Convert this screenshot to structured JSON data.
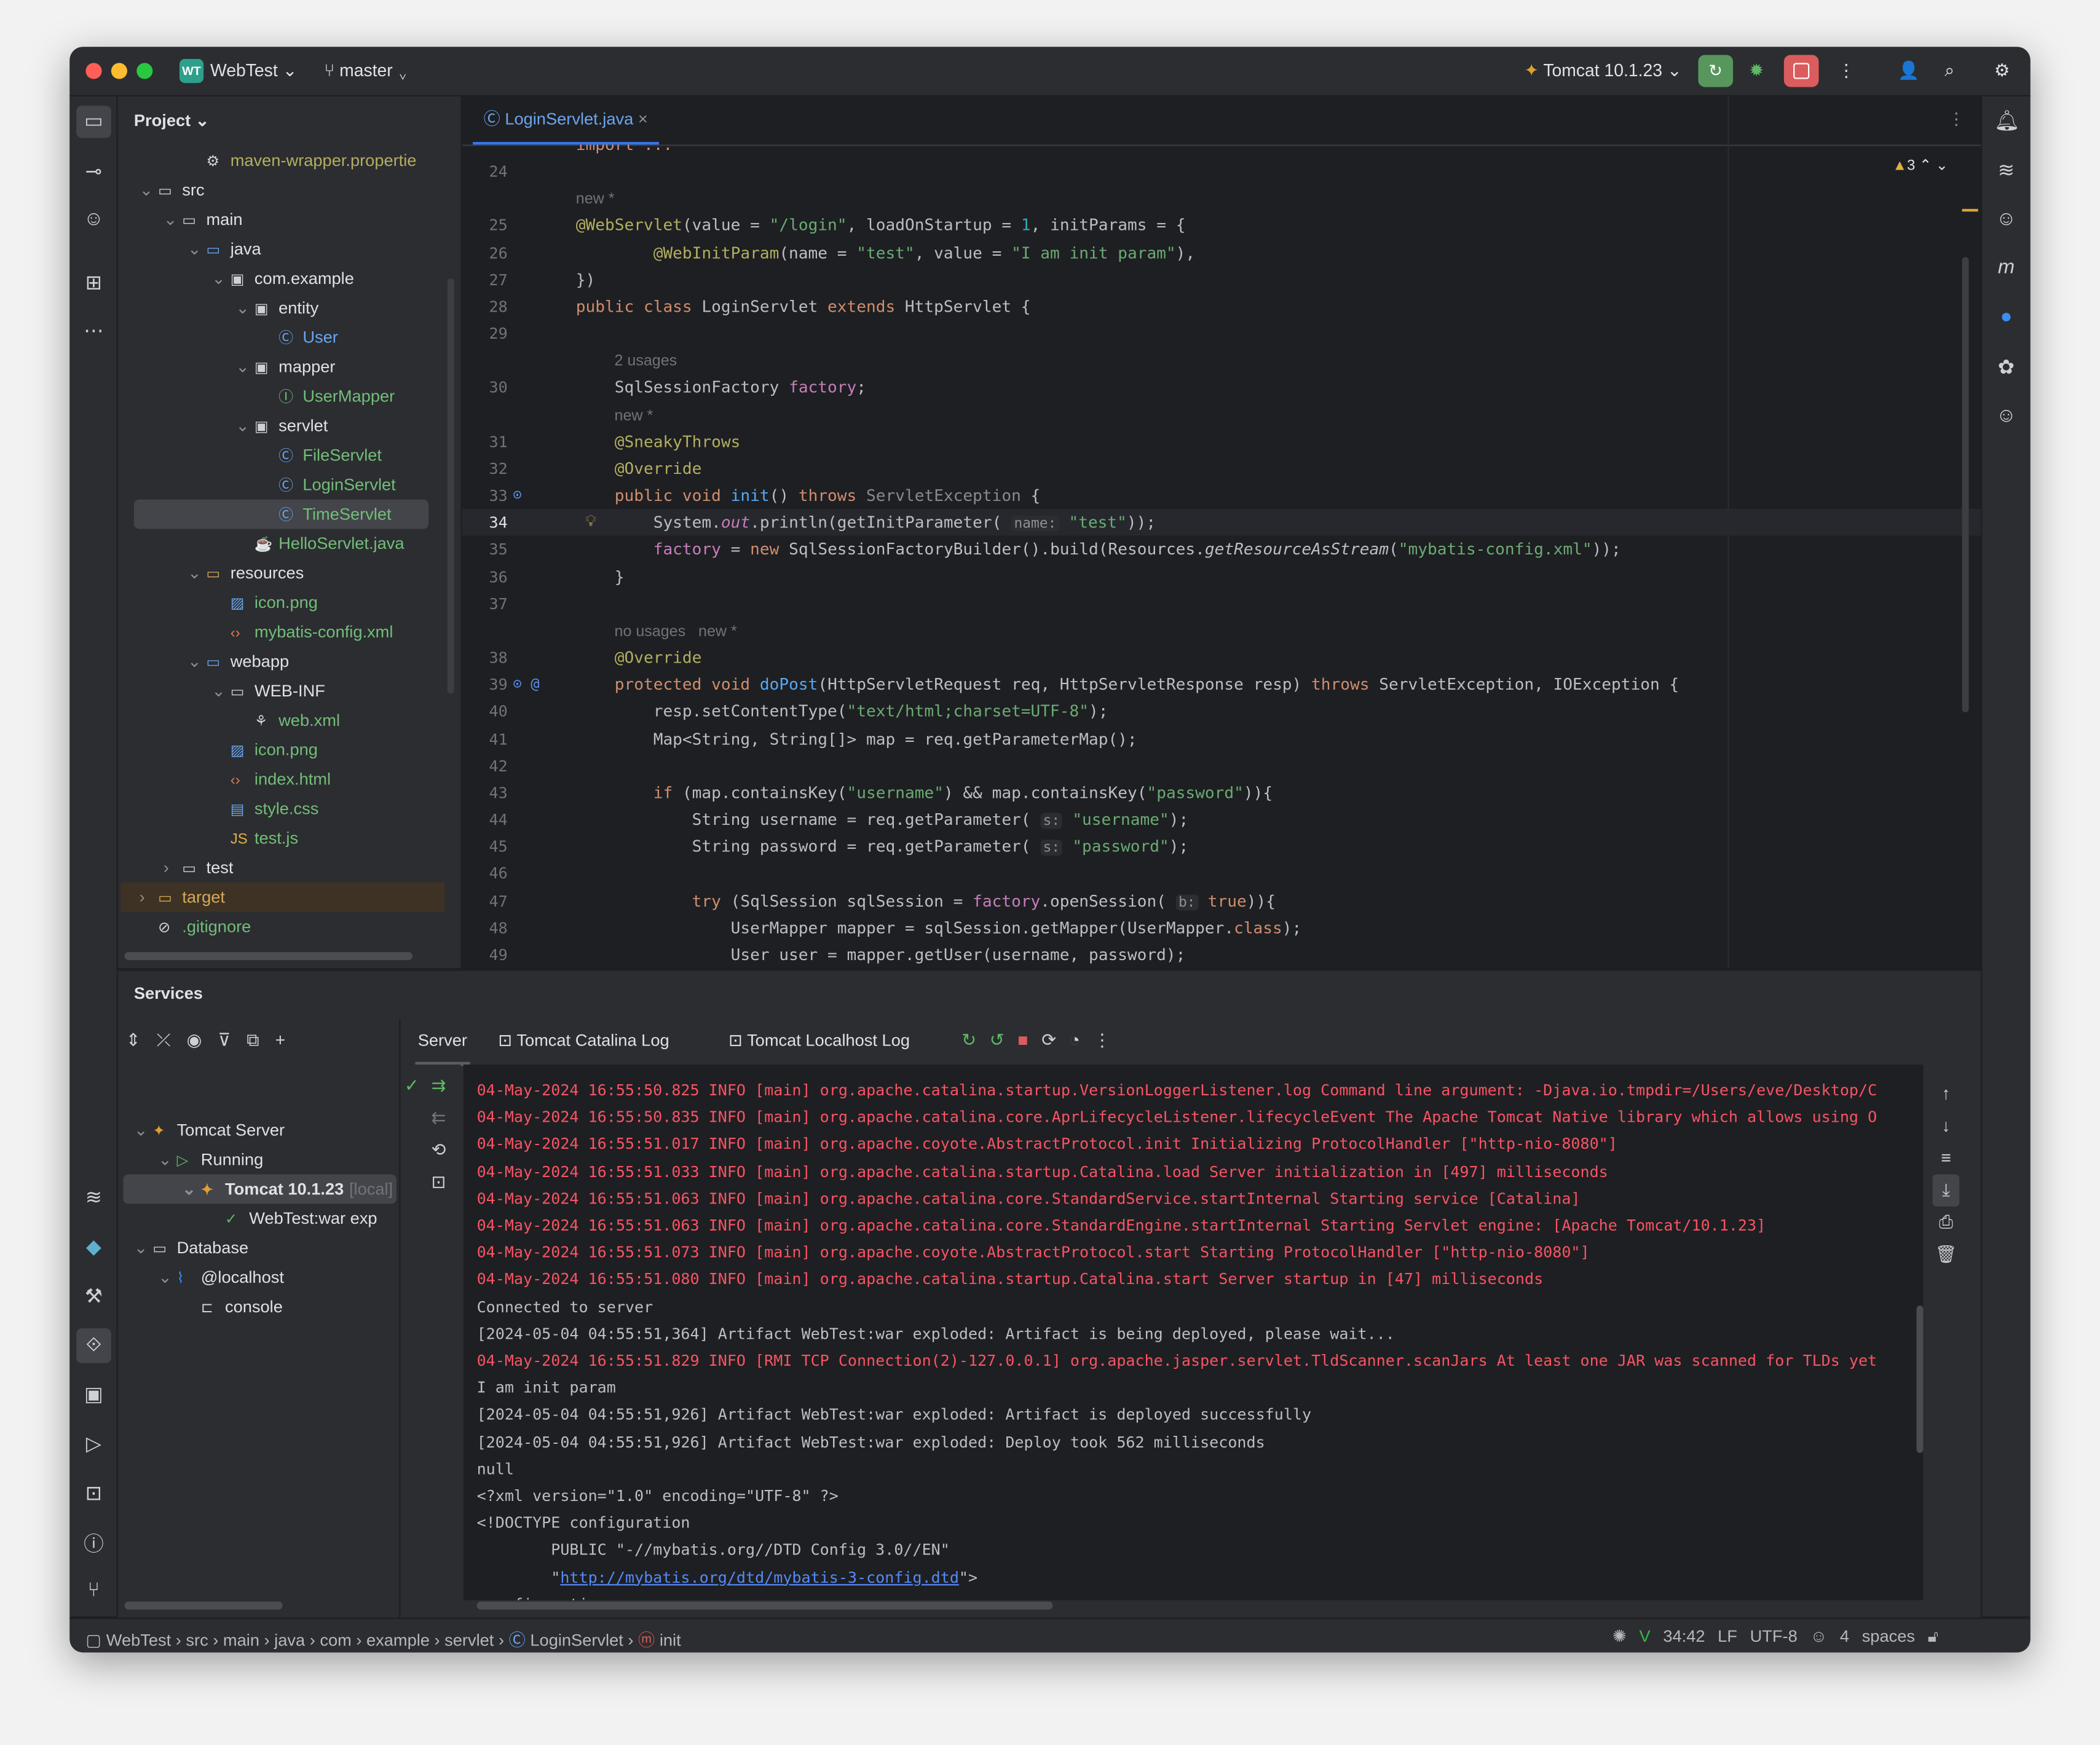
{
  "titlebar": {
    "project_badge": "WT",
    "project": "WebTest",
    "branch": "master",
    "run_config": "Tomcat 10.1.23"
  },
  "colors": {
    "accent": "#3574f0",
    "keyword": "#cf8e6d",
    "annotation": "#b3ae60",
    "string": "#6aab73",
    "error": "#f75464",
    "run_green": "#57965c",
    "stop_red": "#db5c5c"
  },
  "project_panel": {
    "title": "Project",
    "items": [
      {
        "d": 3,
        "icon": "gear",
        "label": "maven-wrapper.propertie",
        "color": "#b3ae60",
        "arrow": ""
      },
      {
        "d": 1,
        "icon": "folder",
        "label": "src",
        "color": "#dfe1e5",
        "arrow": "v"
      },
      {
        "d": 2,
        "icon": "folder",
        "label": "main",
        "color": "#dfe1e5",
        "arrow": "v"
      },
      {
        "d": 3,
        "icon": "folder-src",
        "label": "java",
        "color": "#dfe1e5",
        "arrow": "v"
      },
      {
        "d": 4,
        "icon": "package",
        "label": "com.example",
        "color": "#dfe1e5",
        "arrow": "v"
      },
      {
        "d": 5,
        "icon": "package",
        "label": "entity",
        "color": "#dfe1e5",
        "arrow": "v"
      },
      {
        "d": 6,
        "icon": "class",
        "label": "User",
        "color": "#6aa6f0",
        "arrow": ""
      },
      {
        "d": 5,
        "icon": "package",
        "label": "mapper",
        "color": "#dfe1e5",
        "arrow": "v"
      },
      {
        "d": 6,
        "icon": "interface",
        "label": "UserMapper",
        "color": "#73bd79",
        "arrow": ""
      },
      {
        "d": 5,
        "icon": "package",
        "label": "servlet",
        "color": "#dfe1e5",
        "arrow": "v"
      },
      {
        "d": 6,
        "icon": "class",
        "label": "FileServlet",
        "color": "#73bd79",
        "arrow": ""
      },
      {
        "d": 6,
        "icon": "class",
        "label": "LoginServlet",
        "color": "#73bd79",
        "arrow": ""
      },
      {
        "d": 6,
        "icon": "class",
        "label": "TimeServlet",
        "color": "#73bd79",
        "arrow": "",
        "selected": true
      },
      {
        "d": 5,
        "icon": "java-file",
        "label": "HelloServlet.java",
        "color": "#73bd79",
        "arrow": ""
      },
      {
        "d": 3,
        "icon": "folder-res",
        "label": "resources",
        "color": "#dfe1e5",
        "arrow": "v"
      },
      {
        "d": 4,
        "icon": "image",
        "label": "icon.png",
        "color": "#73bd79",
        "arrow": ""
      },
      {
        "d": 4,
        "icon": "xml",
        "label": "mybatis-config.xml",
        "color": "#73bd79",
        "arrow": ""
      },
      {
        "d": 3,
        "icon": "folder-web",
        "label": "webapp",
        "color": "#dfe1e5",
        "arrow": "v"
      },
      {
        "d": 4,
        "icon": "folder",
        "label": "WEB-INF",
        "color": "#dfe1e5",
        "arrow": "v"
      },
      {
        "d": 5,
        "icon": "web-xml",
        "label": "web.xml",
        "color": "#73bd79",
        "arrow": ""
      },
      {
        "d": 4,
        "icon": "image",
        "label": "icon.png",
        "color": "#73bd79",
        "arrow": ""
      },
      {
        "d": 4,
        "icon": "html",
        "label": "index.html",
        "color": "#73bd79",
        "arrow": ""
      },
      {
        "d": 4,
        "icon": "css",
        "label": "style.css",
        "color": "#73bd79",
        "arrow": ""
      },
      {
        "d": 4,
        "icon": "js",
        "label": "test.js",
        "color": "#73bd79",
        "arrow": ""
      },
      {
        "d": 2,
        "icon": "folder",
        "label": "test",
        "color": "#dfe1e5",
        "arrow": ">"
      },
      {
        "d": 1,
        "icon": "folder-excluded",
        "label": "target",
        "color": "#d5a95b",
        "arrow": ">",
        "excluded": true
      },
      {
        "d": 1,
        "icon": "ignore",
        "label": ".gitignore",
        "color": "#73bd79",
        "arrow": ""
      }
    ]
  },
  "editor": {
    "tab": "LoginServlet.java",
    "warnings": "3",
    "folded_import": "import ...",
    "lines": [
      {
        "n": "24",
        "t": []
      },
      {
        "n": "",
        "hint": "new *",
        "ind": 0
      },
      {
        "n": "25",
        "t": [
          [
            "a",
            "@WebServlet"
          ],
          [
            "t",
            "(value = "
          ],
          [
            "s",
            "\"/login\""
          ],
          [
            "t",
            ", loadOnStartup = "
          ],
          [
            "n",
            "1"
          ],
          [
            "t",
            ", initParams = {"
          ]
        ]
      },
      {
        "n": "26",
        "t": [
          [
            "t",
            "        "
          ],
          [
            "a",
            "@WebInitParam"
          ],
          [
            "t",
            "(name = "
          ],
          [
            "s",
            "\"test\""
          ],
          [
            "t",
            ", value = "
          ],
          [
            "s",
            "\"I am init param\""
          ],
          [
            "t",
            "),"
          ]
        ]
      },
      {
        "n": "27",
        "t": [
          [
            "t",
            "})"
          ]
        ]
      },
      {
        "n": "28",
        "t": [
          [
            "k",
            "public class "
          ],
          [
            "t",
            "LoginServlet "
          ],
          [
            "k",
            "extends "
          ],
          [
            "t",
            "HttpServlet {"
          ]
        ]
      },
      {
        "n": "29",
        "t": []
      },
      {
        "n": "",
        "hint": "2 usages",
        "ind": 4
      },
      {
        "n": "30",
        "t": [
          [
            "t",
            "    SqlSessionFactory "
          ],
          [
            "f",
            "factory"
          ],
          [
            "t",
            ";"
          ]
        ]
      },
      {
        "n": "",
        "hint": "new *",
        "ind": 4
      },
      {
        "n": "31",
        "t": [
          [
            "a",
            "    @SneakyThrows"
          ]
        ]
      },
      {
        "n": "32",
        "t": [
          [
            "a",
            "    @Override"
          ]
        ]
      },
      {
        "n": "33",
        "t": [
          [
            "k",
            "    public void "
          ],
          [
            "fn",
            "init"
          ],
          [
            "t",
            "() "
          ],
          [
            "k",
            "throws "
          ],
          [
            "g",
            "ServletException"
          ],
          [
            "t",
            " {"
          ]
        ],
        "gutter": "override"
      },
      {
        "n": "34",
        "t": [
          [
            "t",
            "        System."
          ],
          [
            "fi",
            "out"
          ],
          [
            "t",
            ".println(getInitParameter( "
          ],
          [
            "h",
            "name:"
          ],
          [
            "t",
            " "
          ],
          [
            "s",
            "\"test\""
          ],
          [
            "t",
            "));"
          ]
        ],
        "current": true
      },
      {
        "n": "35",
        "t": [
          [
            "f",
            "        factory"
          ],
          [
            "t",
            " = "
          ],
          [
            "k",
            "new "
          ],
          [
            "t",
            "SqlSessionFactoryBuilder().build(Resources."
          ],
          [
            "i",
            "getResourceAsStream"
          ],
          [
            "t",
            "("
          ],
          [
            "s",
            "\"mybatis-config.xml\""
          ],
          [
            "t",
            "));"
          ]
        ]
      },
      {
        "n": "36",
        "t": [
          [
            "t",
            "    }"
          ]
        ]
      },
      {
        "n": "37",
        "t": []
      },
      {
        "n": "",
        "hint": "no usages   new *",
        "ind": 4
      },
      {
        "n": "38",
        "t": [
          [
            "a",
            "    @Override"
          ]
        ]
      },
      {
        "n": "39",
        "t": [
          [
            "k",
            "    protected void "
          ],
          [
            "fn",
            "doPost"
          ],
          [
            "t",
            "(HttpServletRequest req, HttpServletResponse resp) "
          ],
          [
            "k",
            "throws "
          ],
          [
            "t",
            "ServletException, IOException {"
          ]
        ],
        "gutter": "override-at"
      },
      {
        "n": "40",
        "t": [
          [
            "t",
            "        resp.setContentType("
          ],
          [
            "s",
            "\"text/html;charset=UTF-8\""
          ],
          [
            "t",
            ");"
          ]
        ]
      },
      {
        "n": "41",
        "t": [
          [
            "t",
            "        Map<String, String[]> map = req.getParameterMap();"
          ]
        ]
      },
      {
        "n": "42",
        "t": []
      },
      {
        "n": "43",
        "t": [
          [
            "k",
            "        if "
          ],
          [
            "t",
            "(map.containsKey("
          ],
          [
            "s",
            "\"username\""
          ],
          [
            "t",
            ") && map.containsKey("
          ],
          [
            "s",
            "\"password\""
          ],
          [
            "t",
            "))"
          ],
          [
            "t",
            "{"
          ]
        ]
      },
      {
        "n": "44",
        "t": [
          [
            "t",
            "            String username = req.getParameter( "
          ],
          [
            "h",
            "s:"
          ],
          [
            "t",
            " "
          ],
          [
            "s",
            "\"username\""
          ],
          [
            "t",
            ");"
          ]
        ]
      },
      {
        "n": "45",
        "t": [
          [
            "t",
            "            String password = req.getParameter( "
          ],
          [
            "h",
            "s:"
          ],
          [
            "t",
            " "
          ],
          [
            "s",
            "\"password\""
          ],
          [
            "t",
            ");"
          ]
        ]
      },
      {
        "n": "46",
        "t": []
      },
      {
        "n": "47",
        "t": [
          [
            "k",
            "            try "
          ],
          [
            "t",
            "(SqlSession sqlSession = "
          ],
          [
            "f",
            "factory"
          ],
          [
            "t",
            ".openSession( "
          ],
          [
            "h",
            "b:"
          ],
          [
            "t",
            " "
          ],
          [
            "k",
            "true"
          ],
          [
            "t",
            ")){"
          ]
        ]
      },
      {
        "n": "48",
        "t": [
          [
            "t",
            "                UserMapper mapper = sqlSession.getMapper(UserMapper."
          ],
          [
            "k",
            "class"
          ],
          [
            "t",
            ");"
          ]
        ]
      },
      {
        "n": "49",
        "t": [
          [
            "t",
            "                User user = mapper.getUser(username, password);"
          ]
        ]
      }
    ]
  },
  "services": {
    "title": "Services",
    "tabs": [
      "Server",
      "Tomcat Catalina Log",
      "Tomcat Localhost Log"
    ],
    "active_tab": "Server",
    "tree": [
      {
        "d": 0,
        "label": "Tomcat Server",
        "icon": "tomcat",
        "arrow": "v"
      },
      {
        "d": 1,
        "label": "Running",
        "icon": "run",
        "arrow": "v"
      },
      {
        "d": 2,
        "label": "Tomcat 10.1.23",
        "suffix": "[local]",
        "icon": "tomcat-running",
        "arrow": "v",
        "selected": true
      },
      {
        "d": 3,
        "label": "WebTest:war exp",
        "icon": "artifact-ok",
        "arrow": ""
      },
      {
        "d": 0,
        "label": "Database",
        "icon": "folder",
        "arrow": "v"
      },
      {
        "d": 1,
        "label": "@localhost",
        "icon": "mysql",
        "arrow": "v"
      },
      {
        "d": 2,
        "label": "console",
        "icon": "console",
        "arrow": ""
      }
    ],
    "log": [
      {
        "c": "red",
        "text": "04-May-2024 16:55:50.825 INFO [main] org.apache.catalina.startup.VersionLoggerListener.log Command line argument: -Djava.io.tmpdir=/Users/eve/Desktop/C"
      },
      {
        "c": "red",
        "text": "04-May-2024 16:55:50.835 INFO [main] org.apache.catalina.core.AprLifecycleListener.lifecycleEvent The Apache Tomcat Native library which allows using O"
      },
      {
        "c": "red",
        "text": "04-May-2024 16:55:51.017 INFO [main] org.apache.coyote.AbstractProtocol.init Initializing ProtocolHandler [\"http-nio-8080\"]"
      },
      {
        "c": "red",
        "text": "04-May-2024 16:55:51.033 INFO [main] org.apache.catalina.startup.Catalina.load Server initialization in [497] milliseconds"
      },
      {
        "c": "red",
        "text": "04-May-2024 16:55:51.063 INFO [main] org.apache.catalina.core.StandardService.startInternal Starting service [Catalina]"
      },
      {
        "c": "red",
        "text": "04-May-2024 16:55:51.063 INFO [main] org.apache.catalina.core.StandardEngine.startInternal Starting Servlet engine: [Apache Tomcat/10.1.23]"
      },
      {
        "c": "red",
        "text": "04-May-2024 16:55:51.073 INFO [main] org.apache.coyote.AbstractProtocol.start Starting ProtocolHandler [\"http-nio-8080\"]"
      },
      {
        "c": "red",
        "text": "04-May-2024 16:55:51.080 INFO [main] org.apache.catalina.startup.Catalina.start Server startup in [47] milliseconds"
      },
      {
        "c": "plain",
        "text": "Connected to server"
      },
      {
        "c": "plain",
        "text": "[2024-05-04 04:55:51,364] Artifact WebTest:war exploded: Artifact is being deployed, please wait..."
      },
      {
        "c": "red",
        "text": "04-May-2024 16:55:51.829 INFO [RMI TCP Connection(2)-127.0.0.1] org.apache.jasper.servlet.TldScanner.scanJars At least one JAR was scanned for TLDs yet"
      },
      {
        "c": "plain",
        "text": "I am init param"
      },
      {
        "c": "plain",
        "text": "[2024-05-04 04:55:51,926] Artifact WebTest:war exploded: Artifact is deployed successfully"
      },
      {
        "c": "plain",
        "text": "[2024-05-04 04:55:51,926] Artifact WebTest:war exploded: Deploy took 562 milliseconds"
      },
      {
        "c": "plain",
        "text": "null"
      },
      {
        "c": "plain",
        "text": "<?xml version=\"1.0\" encoding=\"UTF-8\" ?>"
      },
      {
        "c": "plain",
        "text": "<!DOCTYPE configuration"
      },
      {
        "c": "plain",
        "text": "        PUBLIC \"-//mybatis.org//DTD Config 3.0//EN\""
      },
      {
        "c": "plain",
        "pre": "        \"",
        "link": "http://mybatis.org/dtd/mybatis-3-config.dtd",
        "post": "\">"
      },
      {
        "c": "plain",
        "text": "<configuration>"
      }
    ]
  },
  "statusbar": {
    "breadcrumb": [
      "WebTest",
      "src",
      "main",
      "java",
      "com",
      "example",
      "servlet",
      "LoginServlet",
      "init"
    ],
    "position": "34:42",
    "line_sep": "LF",
    "encoding": "UTF-8",
    "indent": "4 spaces"
  }
}
